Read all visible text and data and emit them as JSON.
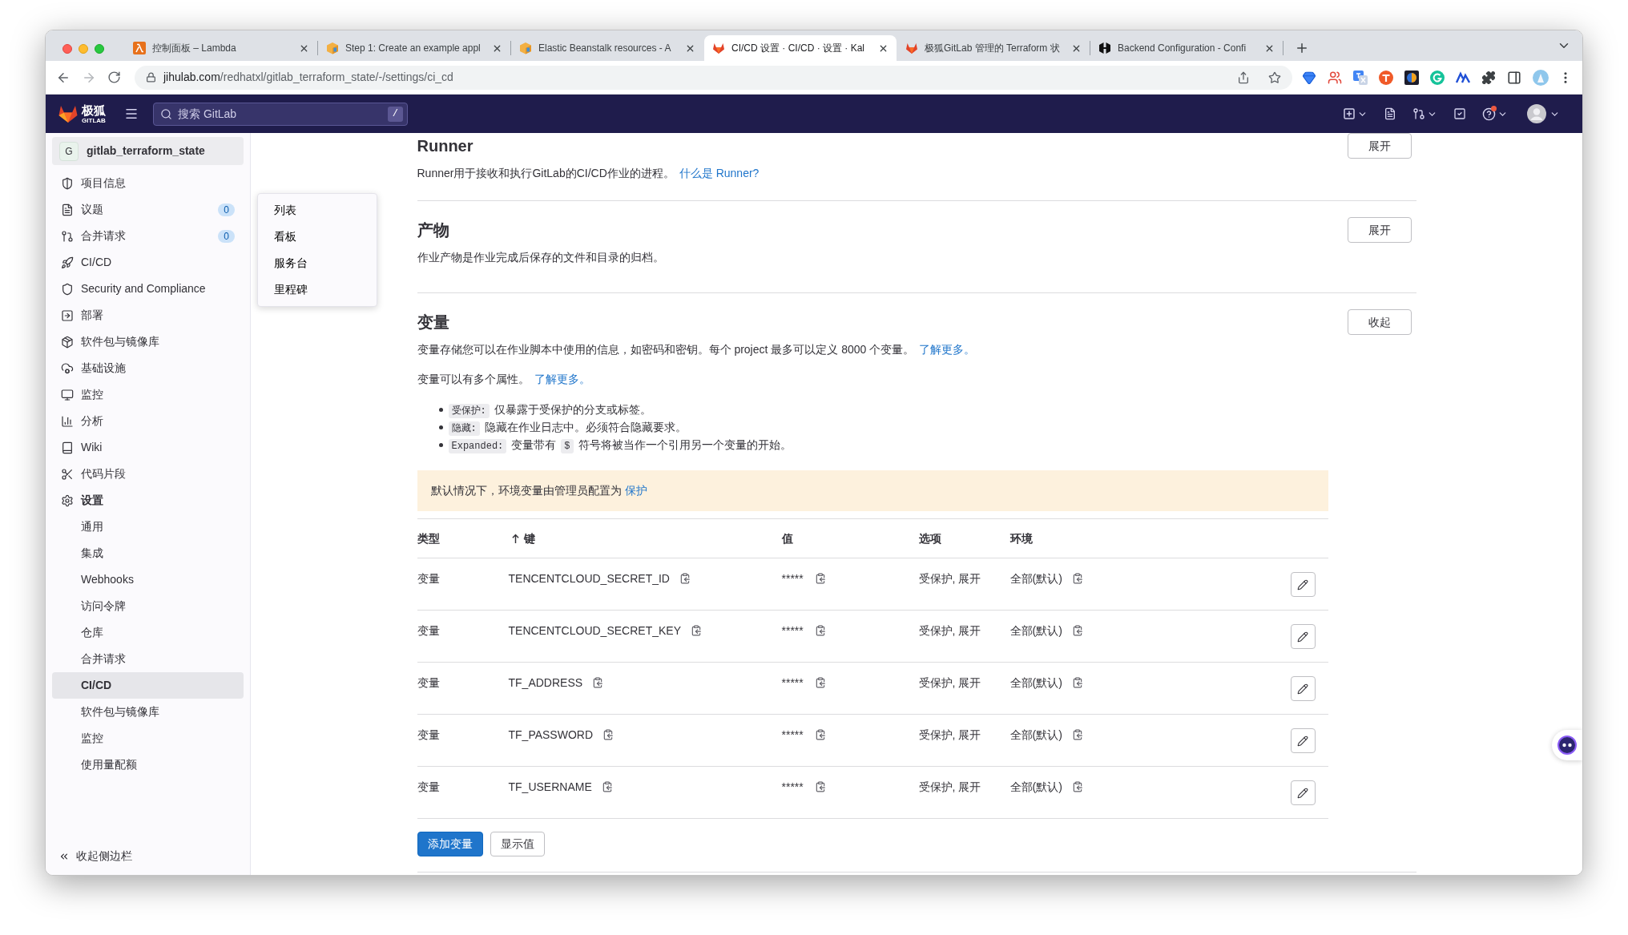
{
  "browser": {
    "tabs": [
      {
        "title": "控制面板 – Lambda",
        "selected": false
      },
      {
        "title": "Step 1: Create an example appl",
        "selected": false
      },
      {
        "title": "Elastic Beanstalk resources - A",
        "selected": false
      },
      {
        "title": "CI/CD 设置 · CI/CD · 设置 · Kal",
        "selected": true
      },
      {
        "title": "极狐GitLab 管理的 Terraform 状",
        "selected": false
      },
      {
        "title": "Backend Configuration - Confi",
        "selected": false
      }
    ],
    "address": {
      "host": "jihulab.com",
      "path": "/redhatxl/gitlab_terraform_state/-/settings/ci_cd"
    }
  },
  "header": {
    "logo_text": "极狐",
    "logo_subtext": "GITLAB",
    "search": {
      "placeholder": "搜索 GitLab",
      "shortcut": "/"
    },
    "help_notification": true
  },
  "sidebar": {
    "project": {
      "avatar": "G",
      "name": "gitlab_terraform_state"
    },
    "items": [
      {
        "label": "项目信息",
        "selected": false
      },
      {
        "label": "议题",
        "count": "0",
        "selected": false,
        "flyout": [
          "列表",
          "看板",
          "服务台",
          "里程碑"
        ]
      },
      {
        "label": "合并请求",
        "count": "0",
        "selected": false
      },
      {
        "label": "CI/CD",
        "selected": false
      },
      {
        "label": "Security and Compliance",
        "selected": false
      },
      {
        "label": "部署",
        "selected": false
      },
      {
        "label": "软件包与镜像库",
        "selected": false
      },
      {
        "label": "基础设施",
        "selected": false
      },
      {
        "label": "监控",
        "selected": false
      },
      {
        "label": "分析",
        "selected": false
      },
      {
        "label": "Wiki",
        "selected": false
      },
      {
        "label": "代码片段",
        "selected": false
      },
      {
        "label": "设置",
        "selected": true,
        "children": [
          {
            "label": "通用",
            "selected": false
          },
          {
            "label": "集成",
            "selected": false
          },
          {
            "label": "Webhooks",
            "selected": false
          },
          {
            "label": "访问令牌",
            "selected": false
          },
          {
            "label": "仓库",
            "selected": false
          },
          {
            "label": "合并请求",
            "selected": false
          },
          {
            "label": "CI/CD",
            "selected": true
          },
          {
            "label": "软件包与镜像库",
            "selected": false
          },
          {
            "label": "监控",
            "selected": false
          },
          {
            "label": "使用量配额",
            "selected": false
          }
        ]
      }
    ],
    "collapse": "收起侧边栏"
  },
  "sections": [
    {
      "title": "Runner",
      "description": "Runner用于接收和执行GitLab的CI/CD作业的进程。",
      "link": "什么是 Runner?",
      "button": "展开"
    },
    {
      "title": "产物",
      "description": "作业产物是作业完成后保存的文件和目录的归档。",
      "button": "展开"
    },
    {
      "title": "变量",
      "description": "变量存储您可以在作业脚本中使用的信息，如密码和密钥。每个 project 最多可以定义 8000 个变量。",
      "link": "了解更多。",
      "button": "收起",
      "body": {
        "note": "变量可以有多个属性。",
        "note_link": "了解更多。",
        "attributes": [
          {
            "parts": [
              {
                "kind": "code",
                "text": "受保护:"
              },
              {
                "kind": "text",
                "text": "仅暴露于受保护的分支或标签。"
              }
            ]
          },
          {
            "parts": [
              {
                "kind": "code",
                "text": "隐藏:"
              },
              {
                "kind": "text",
                "text": "隐藏在作业日志中。必须符合隐藏要求。"
              }
            ]
          },
          {
            "parts": [
              {
                "kind": "code",
                "text": "Expanded:"
              },
              {
                "kind": "text",
                "text": "变量带有"
              },
              {
                "kind": "code",
                "text": "$"
              },
              {
                "kind": "text",
                "text": "符号将被当作一个引用另一个变量的开始。"
              }
            ]
          }
        ],
        "alert": {
          "text": "默认情况下，环境变量由管理员配置为",
          "link": "保护"
        },
        "table": {
          "columns": [
            {
              "label": "类型",
              "sorted": false
            },
            {
              "label": "键",
              "sorted": true
            },
            {
              "label": "值",
              "sorted": false
            },
            {
              "label": "选项",
              "sorted": false
            },
            {
              "label": "环境",
              "sorted": false
            }
          ],
          "rows": [
            {
              "type": "变量",
              "key": "TENCENTCLOUD_SECRET_ID",
              "value": "*****",
              "options": "受保护, 展开",
              "environment": "全部(默认)"
            },
            {
              "type": "变量",
              "key": "TENCENTCLOUD_SECRET_KEY",
              "value": "*****",
              "options": "受保护, 展开",
              "environment": "全部(默认)"
            },
            {
              "type": "变量",
              "key": "TF_ADDRESS",
              "value": "*****",
              "options": "受保护, 展开",
              "environment": "全部(默认)"
            },
            {
              "type": "变量",
              "key": "TF_PASSWORD",
              "value": "*****",
              "options": "受保护, 展开",
              "environment": "全部(默认)"
            },
            {
              "type": "变量",
              "key": "TF_USERNAME",
              "value": "*****",
              "options": "受保护, 展开",
              "environment": "全部(默认)"
            }
          ]
        },
        "actions": [
          {
            "label": "添加变量",
            "kind": "primary"
          },
          {
            "label": "显示值",
            "kind": "secondary"
          }
        ]
      }
    }
  ]
}
